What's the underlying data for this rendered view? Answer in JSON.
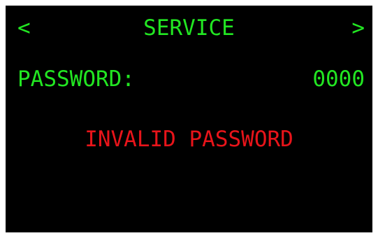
{
  "colors": {
    "background": "#000000",
    "text_primary": "#22e622",
    "error": "#e8141a",
    "frame": "#ffffff"
  },
  "header": {
    "prev_label": "<",
    "prev_icon": "chevron-left-icon",
    "title": "SERVICE",
    "next_label": ">",
    "next_icon": "chevron-right-icon"
  },
  "password": {
    "label": "PASSWORD:",
    "value": "0000"
  },
  "status": {
    "message": "INVALID PASSWORD"
  }
}
